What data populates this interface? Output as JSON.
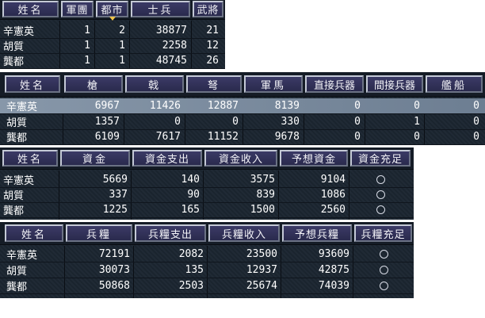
{
  "table1": {
    "headers": [
      "姓名",
      "軍團",
      "都市",
      "士兵",
      "武將"
    ],
    "sorted_col": 2,
    "rows": [
      {
        "name": "辛憲英",
        "army": "1",
        "city": "2",
        "soldiers": "38877",
        "generals": "21"
      },
      {
        "name": "胡質",
        "army": "1",
        "city": "1",
        "soldiers": "2258",
        "generals": "12"
      },
      {
        "name": "龔都",
        "army": "1",
        "city": "1",
        "soldiers": "48745",
        "generals": "26"
      }
    ]
  },
  "table2": {
    "headers": [
      "姓名",
      "槍",
      "戟",
      "弩",
      "軍馬",
      "直接兵器",
      "間接兵器",
      "艦船"
    ],
    "selected_row": 0,
    "rows": [
      {
        "name": "辛憲英",
        "spear": "6967",
        "halberd": "11426",
        "crossbow": "12887",
        "horse": "8139",
        "direct": "0",
        "indirect": "0",
        "ships": "0"
      },
      {
        "name": "胡質",
        "spear": "1357",
        "halberd": "0",
        "crossbow": "0",
        "horse": "330",
        "direct": "0",
        "indirect": "1",
        "ships": "0"
      },
      {
        "name": "龔都",
        "spear": "6109",
        "halberd": "7617",
        "crossbow": "11152",
        "horse": "9678",
        "direct": "0",
        "indirect": "0",
        "ships": "0"
      }
    ]
  },
  "table3": {
    "headers": [
      "姓名",
      "資金",
      "資金支出",
      "資金收入",
      "予想資金",
      "資金充足"
    ],
    "rows": [
      {
        "name": "辛憲英",
        "funds": "5669",
        "spend": "140",
        "income": "3575",
        "forecast": "9104",
        "sufficient": "○"
      },
      {
        "name": "胡質",
        "funds": "337",
        "spend": "90",
        "income": "839",
        "forecast": "1086",
        "sufficient": "○"
      },
      {
        "name": "龔都",
        "funds": "1225",
        "spend": "165",
        "income": "1500",
        "forecast": "2560",
        "sufficient": "○"
      }
    ]
  },
  "table4": {
    "headers": [
      "姓名",
      "兵糧",
      "兵糧支出",
      "兵糧收入",
      "予想兵糧",
      "兵糧充足"
    ],
    "rows": [
      {
        "name": "辛憲英",
        "food": "72191",
        "spend": "2082",
        "income": "23500",
        "forecast": "93609",
        "sufficient": "○"
      },
      {
        "name": "胡質",
        "food": "30073",
        "spend": "135",
        "income": "12937",
        "forecast": "42875",
        "sufficient": "○"
      },
      {
        "name": "龔都",
        "food": "50868",
        "spend": "2503",
        "income": "25674",
        "forecast": "74039",
        "sufficient": "○"
      }
    ]
  },
  "colors": {
    "panel_bg": "#1b2530",
    "header_button": "#2f2f58",
    "selected_row": "#7d8da0",
    "sort_marker": "#f0c24a"
  }
}
